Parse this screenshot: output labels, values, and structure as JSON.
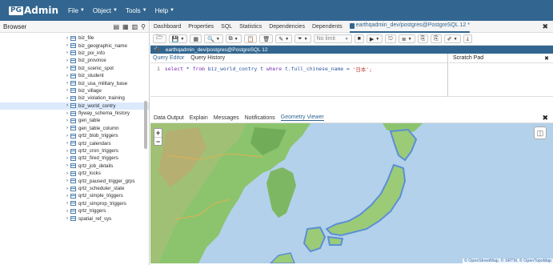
{
  "app": {
    "logo_box": "PG",
    "logo_text": "Admin"
  },
  "menu": [
    "File",
    "Object",
    "Tools",
    "Help"
  ],
  "browser": {
    "title": "Browser",
    "items": [
      "biz_file",
      "biz_geographic_name",
      "biz_poi_info",
      "biz_province",
      "biz_scenic_spot",
      "biz_student",
      "biz_usa_military_base",
      "biz_village",
      "biz_violation_training",
      "biz_world_contry",
      "flyway_schema_history",
      "gen_table",
      "gen_table_column",
      "qrtz_blob_triggers",
      "qrtz_calendars",
      "qrtz_cron_triggers",
      "qrtz_fired_triggers",
      "qrtz_job_details",
      "qrtz_locks",
      "qrtz_paused_trigger_grps",
      "qrtz_scheduler_state",
      "qrtz_simple_triggers",
      "qrtz_simprop_triggers",
      "qrtz_triggers",
      "spatial_ref_sys"
    ],
    "selected_index": 9
  },
  "tabs": {
    "items": [
      "Dashboard",
      "Properties",
      "SQL",
      "Statistics",
      "Dependencies",
      "Dependents"
    ],
    "active": "earthqadmin_dev/postgres@PostgreSQL 12 *"
  },
  "toolbar": {
    "limit": "No limit"
  },
  "connection": "earthqadmin_dev/postgres@PostgreSQL 12",
  "editor": {
    "tabs": [
      "Query Editor",
      "Query History"
    ],
    "line_number": "1",
    "sql": {
      "kw1": "select",
      "mid1": " * ",
      "kw2": "from",
      "mid2": " biz_world_contry t ",
      "kw3": "where",
      "mid3": " t.full_chinese_name = ",
      "str": "'日本';"
    }
  },
  "scratch": {
    "title": "Scratch Pad"
  },
  "output": {
    "tabs": [
      "Data Output",
      "Explain",
      "Messages",
      "Notifications",
      "Geometry Viewer"
    ]
  },
  "map": {
    "zoom_in": "+",
    "zoom_out": "−",
    "attribution": "© OpenStreetMap, © SRTM, © OpenTopoMap",
    "colors": {
      "sea": "#b3d1ea",
      "land_low": "#8cc46e",
      "land_high": "#c8a070",
      "highlight": "#5b8fd4"
    }
  }
}
